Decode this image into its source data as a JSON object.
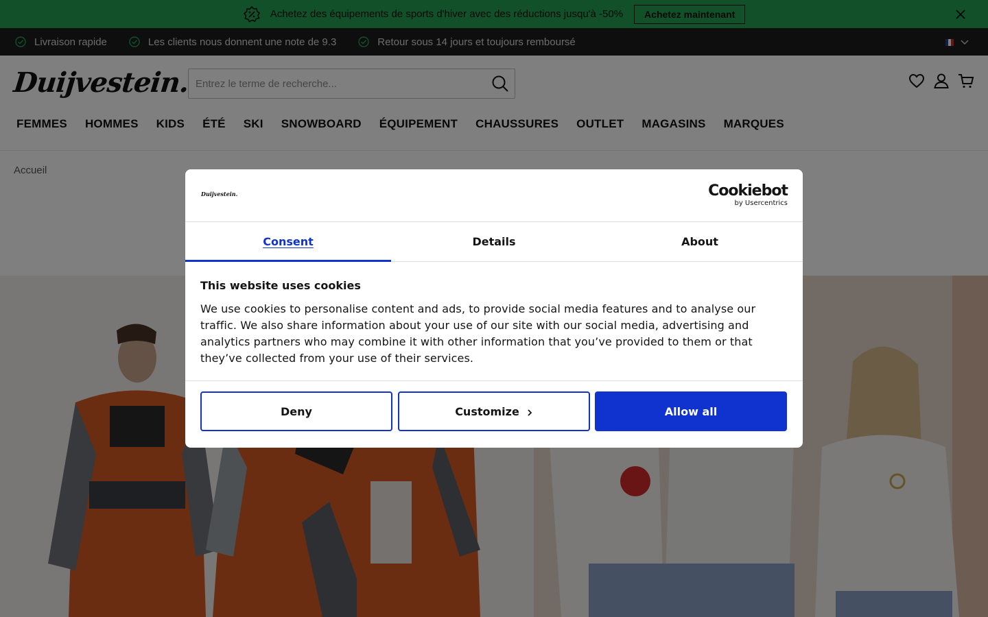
{
  "promo": {
    "text": "Achetez des équipements de sports d'hiver avec des réductions jusqu'à -50%",
    "cta": "Achetez maintenant",
    "icon": "discount-badge-icon",
    "bg_color": "#22a052"
  },
  "usp": {
    "items": [
      "Livraison rapide",
      "Les clients nous donnent une note de 9.3",
      "Retour sous 14 jours et toujours remboursé"
    ]
  },
  "header": {
    "logo": "Duijvestein.",
    "search_placeholder": "Entrez le terme de recherche...",
    "nav": [
      "FEMMES",
      "HOMMES",
      "KIDS",
      "ÉTÉ",
      "SKI",
      "SNOWBOARD",
      "ÉQUIPEMENT",
      "CHAUSSURES",
      "OUTLET",
      "MAGASINS",
      "MARQUES"
    ]
  },
  "breadcrumb": "Accueil",
  "dialog": {
    "logo": "Duijvestein.",
    "brand": "Cookiebot",
    "brand_sub": "by Usercentrics",
    "tabs": [
      "Consent",
      "Details",
      "About"
    ],
    "active_tab": "Consent",
    "title": "This website uses cookies",
    "body": "We use cookies to personalise content and ads, to provide social media features and to analyse our traffic. We also share information about your use of our site with our social media, advertising and analytics partners who may combine it with other information that you’ve provided to them or that they’ve collected from your use of their services.",
    "buttons": {
      "deny": "Deny",
      "customize": "Customize",
      "allow": "Allow all"
    },
    "accent_color": "#1032cf"
  }
}
